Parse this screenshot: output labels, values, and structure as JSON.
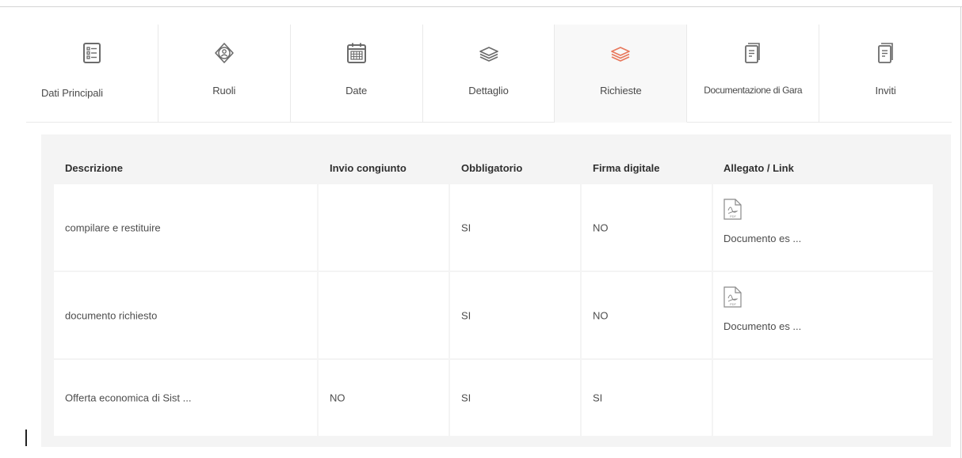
{
  "tabs": [
    {
      "label": "Dati Principali",
      "icon": "list-form-icon",
      "active": false
    },
    {
      "label": "Ruoli",
      "icon": "user-roles-icon",
      "active": false
    },
    {
      "label": "Date",
      "icon": "calendar-icon",
      "active": false
    },
    {
      "label": "Dettaglio",
      "icon": "layers-icon",
      "active": false
    },
    {
      "label": "Richieste",
      "icon": "layers-icon",
      "active": true
    },
    {
      "label": "Documentazione di Gara",
      "icon": "document-icon",
      "active": false
    },
    {
      "label": "Inviti",
      "icon": "document-icon",
      "active": false
    }
  ],
  "table": {
    "headers": {
      "descrizione": "Descrizione",
      "invio": "Invio congiunto",
      "obbligatorio": "Obbligatorio",
      "firma": "Firma digitale",
      "allegato": "Allegato / Link"
    },
    "rows": [
      {
        "descrizione": "compilare e restituire",
        "invio": "",
        "obbligatorio": "SI",
        "firma": "NO",
        "allegato": "Documento es ...",
        "has_pdf": true
      },
      {
        "descrizione": "documento richiesto",
        "invio": "",
        "obbligatorio": "SI",
        "firma": "NO",
        "allegato": "Documento es ...",
        "has_pdf": true
      },
      {
        "descrizione": "Offerta economica di Sist ...",
        "invio": "NO",
        "obbligatorio": "SI",
        "firma": "SI",
        "allegato": "",
        "has_pdf": false
      }
    ]
  },
  "colors": {
    "accent": "#e8785c",
    "icon_gray": "#6b6b6b",
    "panel_bg": "#f4f4f4",
    "active_tab_bg": "#f8f8f8"
  }
}
